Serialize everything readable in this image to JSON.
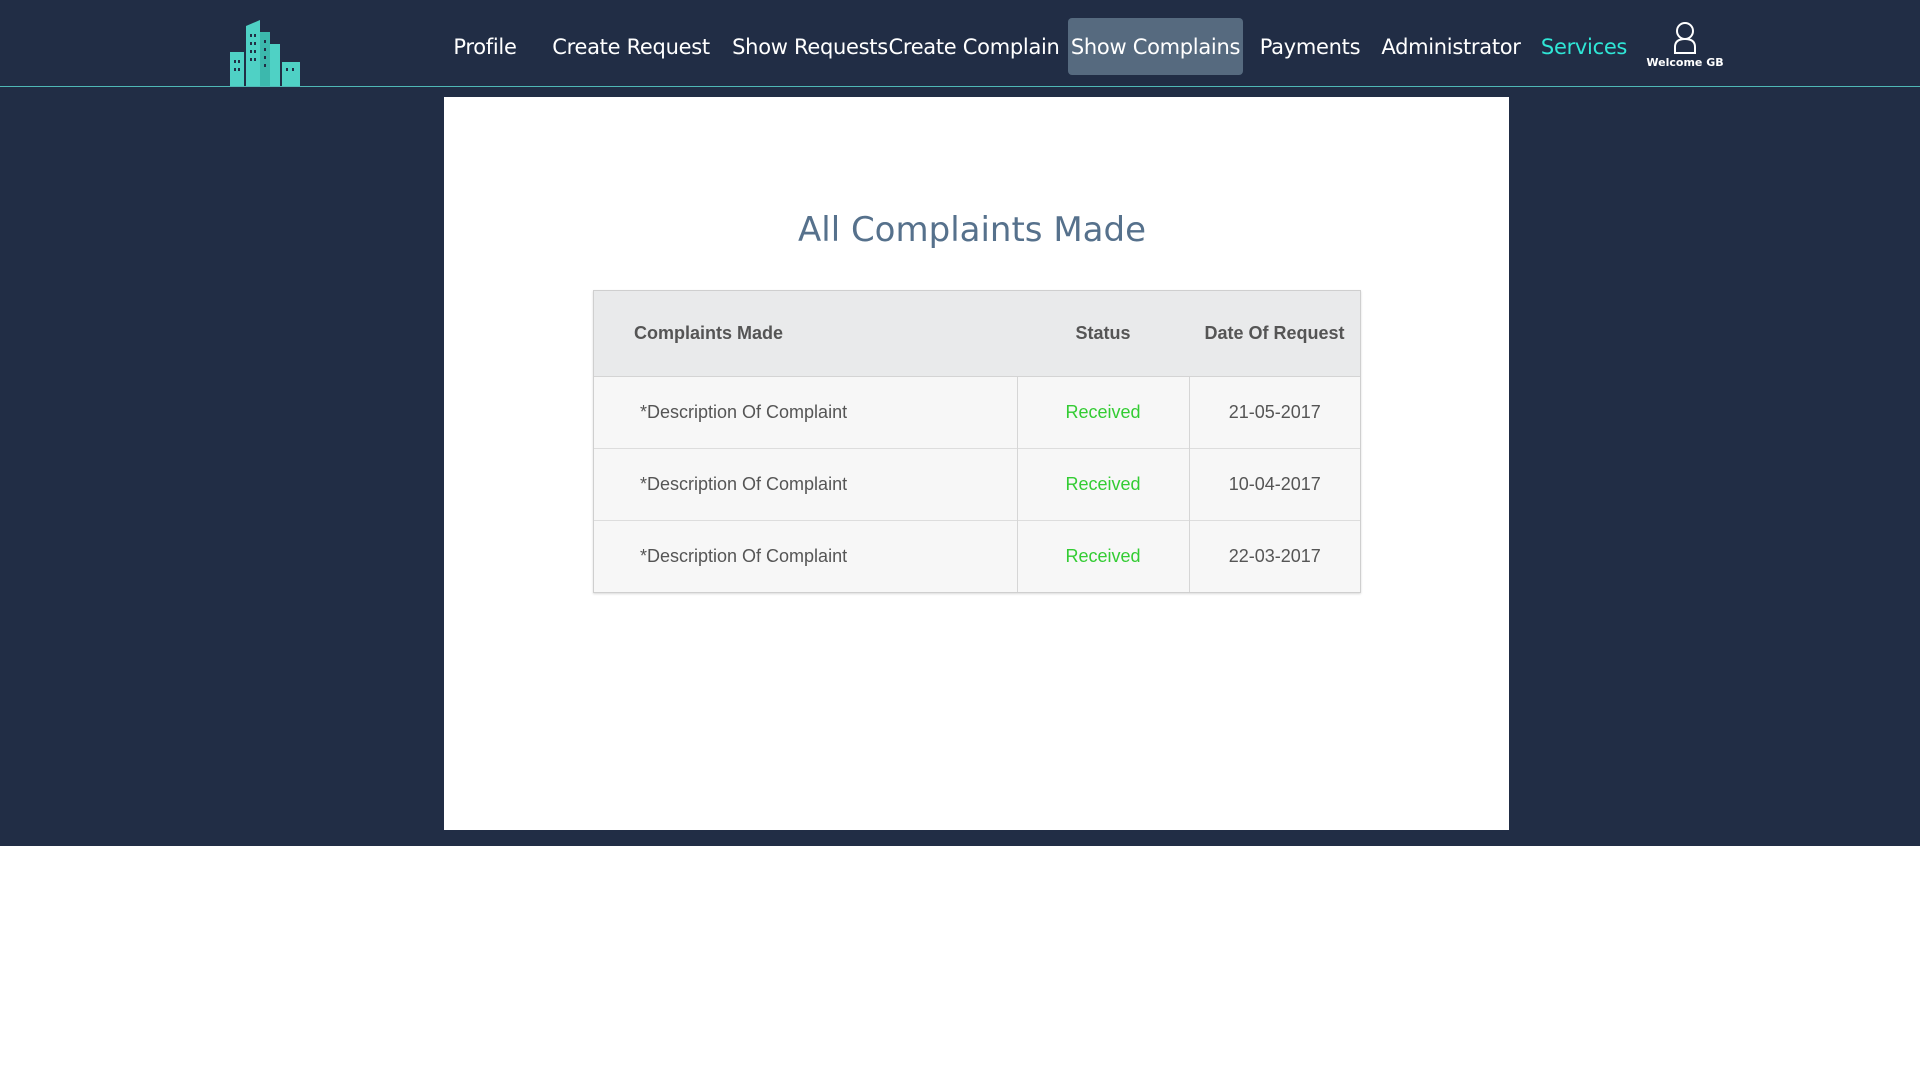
{
  "nav": {
    "items": [
      {
        "label": "Profile"
      },
      {
        "label": "Create Request"
      },
      {
        "label": "Show Requests"
      },
      {
        "label": "Create Complain"
      },
      {
        "label": "Show Complains"
      },
      {
        "label": "Payments"
      },
      {
        "label": "Administrator"
      },
      {
        "label": "Services"
      }
    ],
    "active": "Show Complains",
    "user_caption": "Welcome GB"
  },
  "icons": {
    "logo": "building-logo-icon",
    "user": "user-icon"
  },
  "colors": {
    "background": "#212d45",
    "accent": "#2fe6d6",
    "active_tab": "#566a7f",
    "title": "#56718c",
    "status_received": "#33cc33"
  },
  "main": {
    "title": "All Complaints Made",
    "table": {
      "headers": [
        "Complaints Made",
        "Status",
        "Date Of Request"
      ],
      "rows": [
        {
          "description": "*Description Of Complaint",
          "status": "Received",
          "date": "21-05-2017"
        },
        {
          "description": "*Description Of Complaint",
          "status": "Received",
          "date": "10-04-2017"
        },
        {
          "description": "*Description Of Complaint",
          "status": "Received",
          "date": "22-03-2017"
        }
      ]
    }
  }
}
